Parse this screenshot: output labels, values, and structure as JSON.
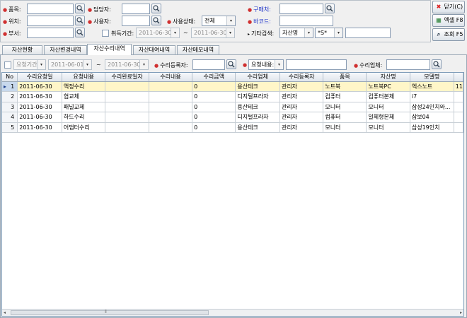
{
  "filters": {
    "item_label": "품목:",
    "location_label": "위치:",
    "dept_label": "부서:",
    "manager_label": "담당자:",
    "user_label": "사용자:",
    "acquire_label": "취득기간:",
    "acquire_from": "2011-06-30",
    "acquire_to": "2011-06-30",
    "range_sep": "~",
    "usage_label": "사용상태:",
    "usage_value": "전체",
    "buyer_label": "구매처:",
    "barcode_label": "바코드:",
    "other_search_label": "기타검색:",
    "other_search_field": "자산명",
    "other_search_op": "*S*"
  },
  "buttons": {
    "close": "닫기(C)",
    "excel": "엑셀 F8",
    "search": "조회 F5"
  },
  "tabs": [
    "자산현황",
    "자산변경내역",
    "자산수리내역",
    "자산대여내역",
    "자산메모내역"
  ],
  "active_tab": 2,
  "repair_filter": {
    "request_period_label": "요청기간:",
    "from": "2011-06-01",
    "sep": "~",
    "to": "2011-06-30",
    "registrant_label": "수리등록자:",
    "content_label": "요청내용:",
    "vendor_label": "수리업체:"
  },
  "grid": {
    "columns": [
      "No",
      "수리요청일",
      "요청내용",
      "수리완료일자",
      "수리내용",
      "수리금액",
      "수리업체",
      "수리등록자",
      "품목",
      "자산명",
      "모델명"
    ],
    "rows": [
      [
        "1",
        "2011-06-30",
        "액정수리",
        "",
        "",
        "0",
        "용산테크",
        "관리자",
        "노트북",
        "노트북PC",
        "엑스노트",
        "11"
      ],
      [
        "2",
        "2011-06-30",
        "협교체",
        "",
        "",
        "0",
        "디지털프라자",
        "관리자",
        "컴퓨터",
        "컴퓨터본체",
        "i7",
        ""
      ],
      [
        "3",
        "2011-06-30",
        "패널교체",
        "",
        "",
        "0",
        "용산테크",
        "관리자",
        "모니터",
        "모니터",
        "삼성24인치와...",
        ""
      ],
      [
        "4",
        "2011-06-30",
        "하드수리",
        "",
        "",
        "0",
        "디지털프라자",
        "관리자",
        "컴퓨터",
        "일체형본체",
        "삼보04",
        ""
      ],
      [
        "5",
        "2011-06-30",
        "어댑터수리",
        "",
        "",
        "0",
        "용산테크",
        "관리자",
        "모니터",
        "모니터",
        "삼성19인치",
        ""
      ]
    ]
  }
}
